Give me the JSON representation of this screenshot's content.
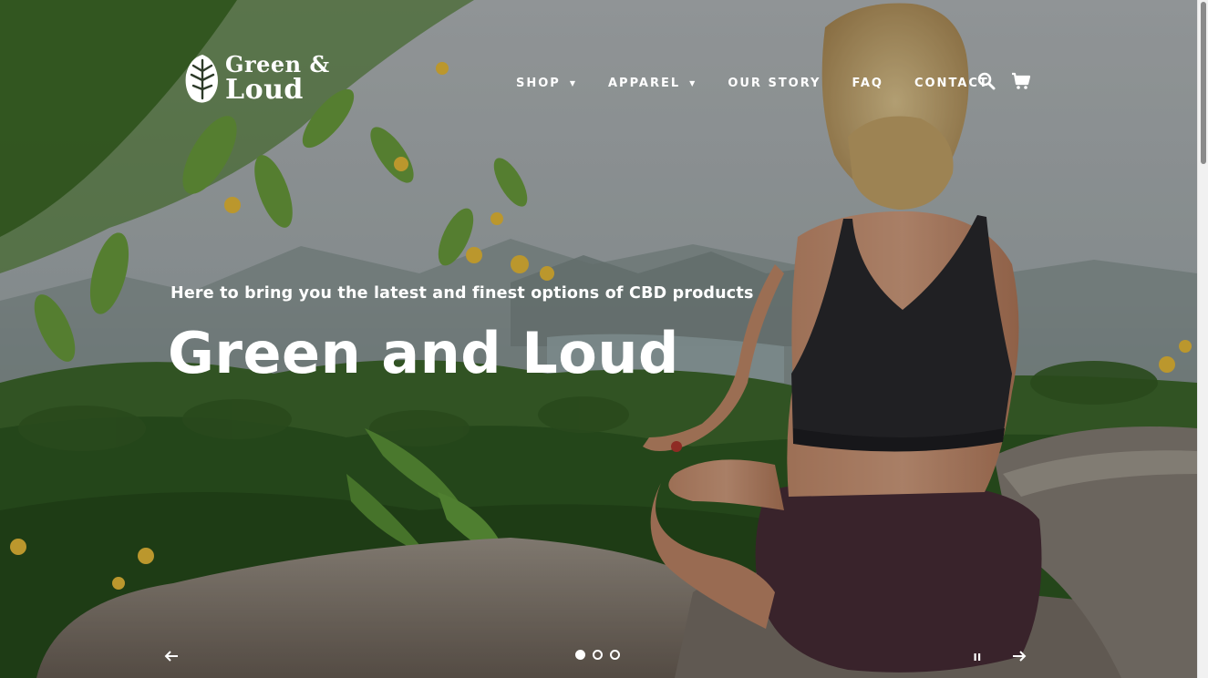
{
  "brand": {
    "logo_line1": "Green &",
    "logo_line2": "Loud"
  },
  "nav": {
    "items": [
      {
        "label": "SHOP",
        "has_dropdown": true
      },
      {
        "label": "APPAREL",
        "has_dropdown": true
      },
      {
        "label": "OUR STORY",
        "has_dropdown": false
      },
      {
        "label": "FAQ",
        "has_dropdown": false
      },
      {
        "label": "CONTACT",
        "has_dropdown": false
      }
    ],
    "caret_glyph": "▼",
    "search_icon": "search-icon",
    "cart_icon": "cart-icon"
  },
  "hero": {
    "subtitle": "Here to bring you the latest and finest options of CBD products",
    "title": "Green and Loud"
  },
  "slideshow": {
    "slide_count": 3,
    "active_index": 0,
    "prev_icon": "arrow-left-icon",
    "next_icon": "arrow-right-icon",
    "pause_icon": "pause-icon"
  },
  "colors": {
    "text": "#ffffff",
    "scrollbar_track": "#f1f1f1",
    "scrollbar_thumb": "#8a8a8a"
  }
}
